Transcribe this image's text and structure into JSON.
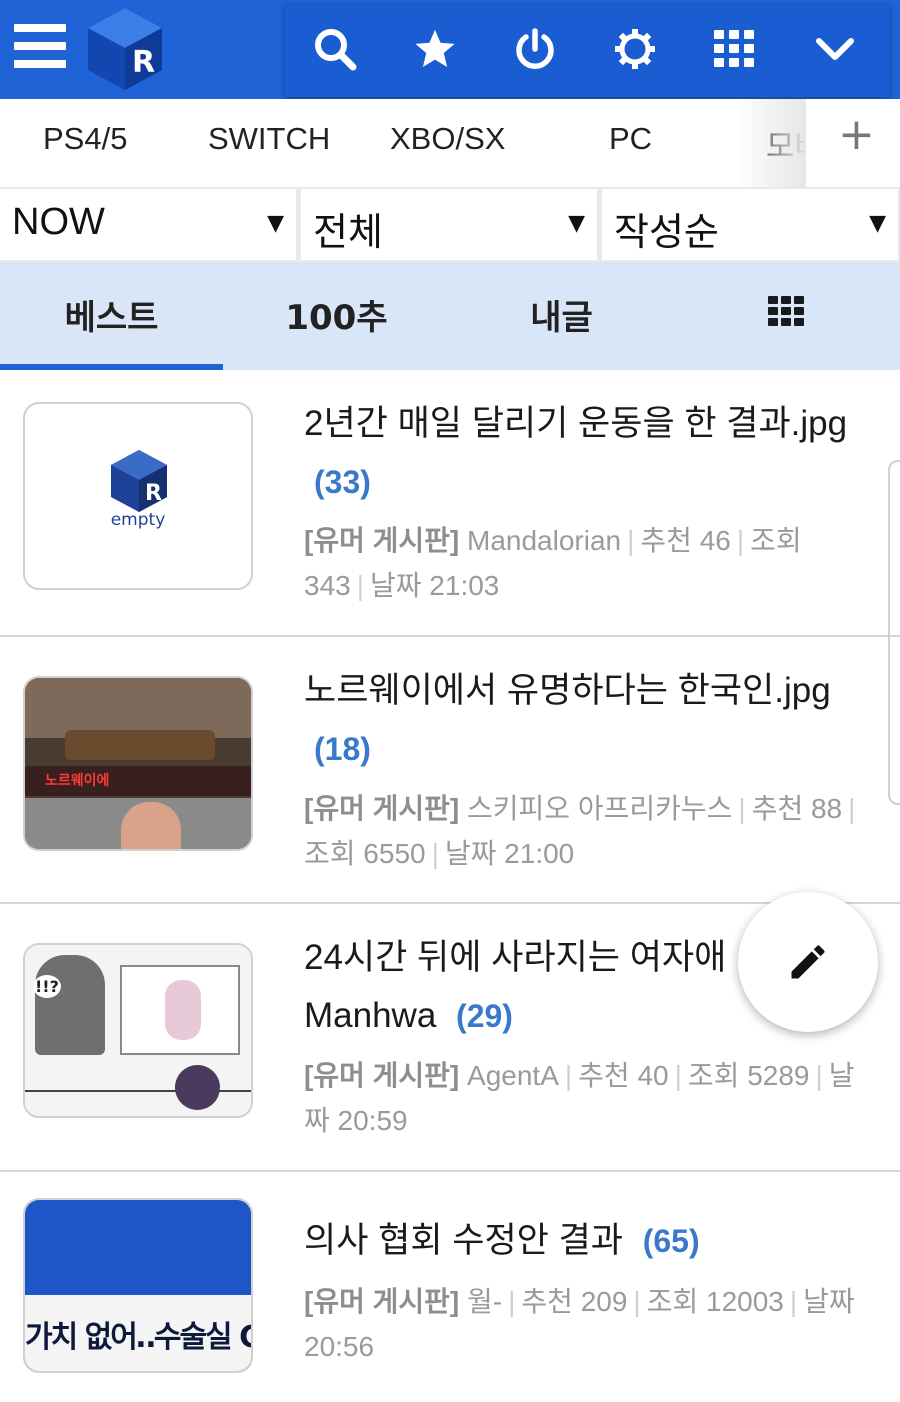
{
  "header": {
    "menu_icon": "hamburger-icon",
    "logo_icon": "ruliweb-logo-icon",
    "tools": [
      "search-icon",
      "star-icon",
      "power-icon",
      "gear-icon",
      "grid-icon",
      "chevron-down-icon"
    ],
    "color": "#1f63d6"
  },
  "platform_tabs": [
    "PS4/5",
    "SWITCH",
    "XBO/SX",
    "PC",
    "모바"
  ],
  "platform_add_label": "+",
  "filters": [
    {
      "value": "NOW"
    },
    {
      "value": "전체"
    },
    {
      "value": "작성순"
    }
  ],
  "filter_arrow": "▼",
  "board_tabs": [
    "베스트",
    "100추",
    "내글"
  ],
  "board_grid_icon": "grid-icon",
  "posts": [
    {
      "title": "2년간 매일 달리기 운동을 한 결과.jpg",
      "count": "(33)",
      "board": "[유머 게시판]",
      "author": "Mandalorian",
      "likes": "추천 46",
      "views": "조회 343",
      "date": "날짜 21:03",
      "thumb_text": "empty"
    },
    {
      "title": "노르웨이에서 유명하다는 한국인.jpg",
      "count": "(18)",
      "board": "[유머 게시판]",
      "author": "스키피오 아프리카누스",
      "likes": "추천 88",
      "views": "조회 6550",
      "date": "날짜 21:00",
      "thumb_caption": "노르웨이에 "
    },
    {
      "title": "24시간 뒤에 사라지는 여자애 Manhwa",
      "count": "(29)",
      "board": "[유머 게시판]",
      "author": "AgentA",
      "likes": "추천 40",
      "views": "조회 5289",
      "date": "날짜 20:59",
      "thumb_caption": "!!?"
    },
    {
      "title": "의사 협회 수정안 결과",
      "count": "(65)",
      "board": "[유머 게시판]",
      "author": "월-",
      "likes": "추천 209",
      "views": "조회 12003",
      "date": "날짜 20:56",
      "thumb_caption": "가치 없어‥수술실 C("
    }
  ],
  "fab_icon": "pencil-icon"
}
